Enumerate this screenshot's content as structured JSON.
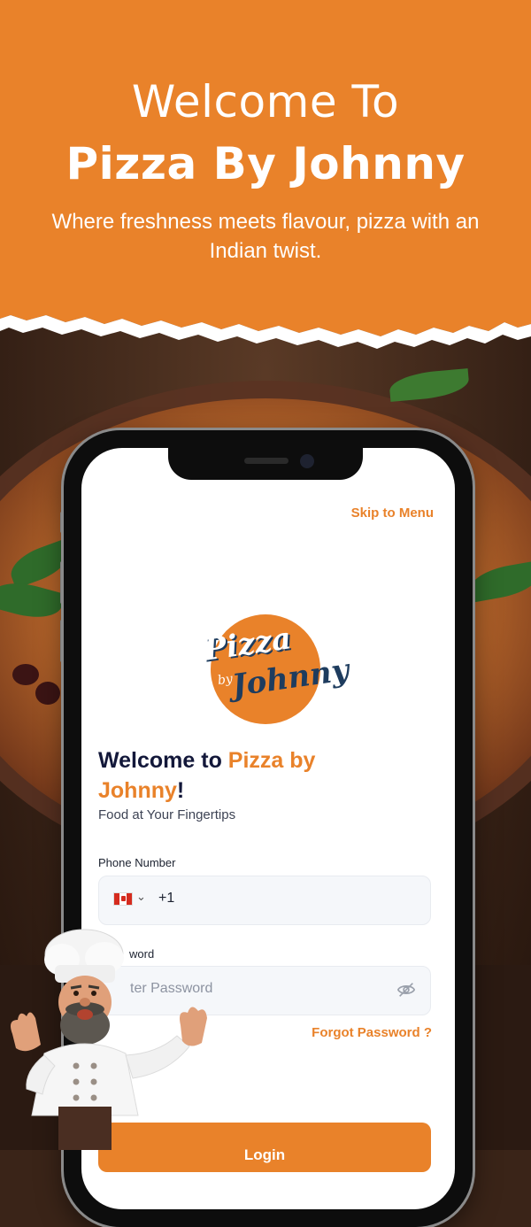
{
  "header": {
    "title_line1": "Welcome To",
    "title_line2": "Pizza By Johnny",
    "subtitle": "Where freshness meets flavour, pizza with an Indian twist."
  },
  "app": {
    "skip_label": "Skip to Menu",
    "logo": {
      "line1": "Pizza",
      "by": "by",
      "line2": "Johnny"
    },
    "welcome_prefix": "Welcome to ",
    "welcome_brand": "Pizza by Johnny",
    "welcome_suffix": "!",
    "tagline": "Food at Your Fingertips",
    "phone": {
      "label": "Phone Number",
      "country_flag": "canada-flag-icon",
      "dial_code": "+1"
    },
    "password": {
      "label": "Password",
      "label_visible": "word",
      "placeholder_visible": "ter Password"
    },
    "forgot_label": "Forgot Password ?",
    "login_label": "Login"
  },
  "colors": {
    "accent": "#E9822A",
    "navy": "#13183A",
    "field_bg": "#F5F7FA"
  }
}
